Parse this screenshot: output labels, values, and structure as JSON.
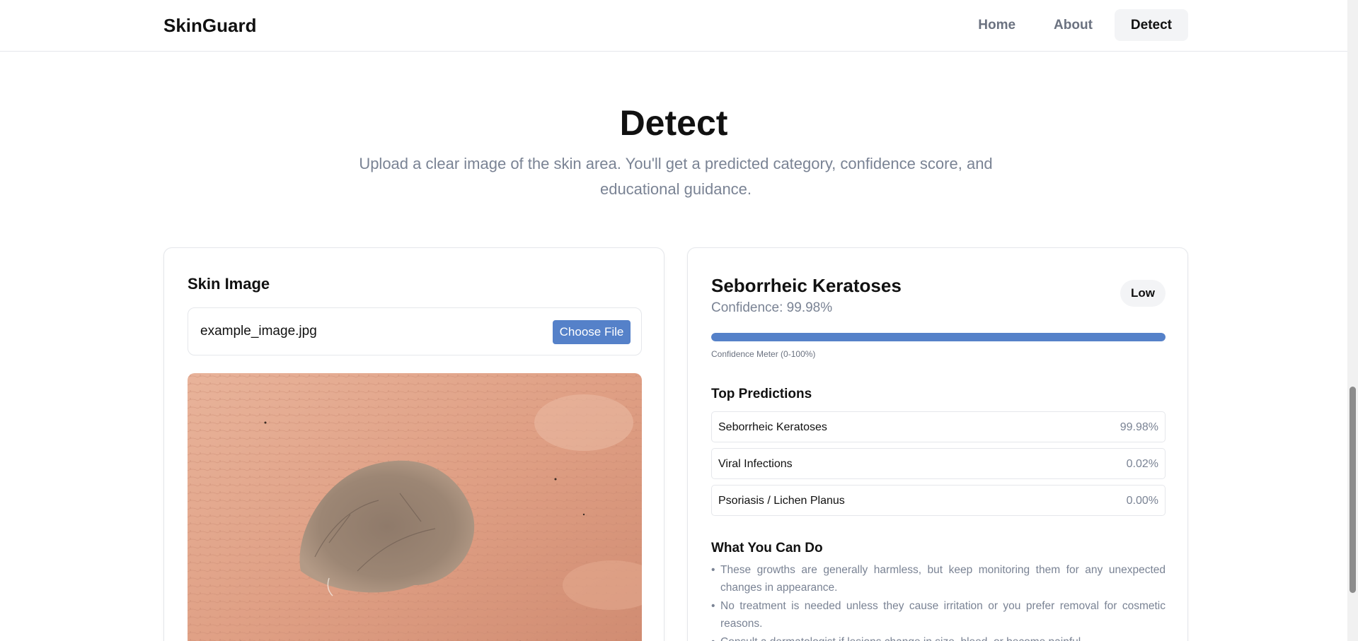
{
  "nav": {
    "brand": "SkinGuard",
    "links": [
      {
        "label": "Home"
      },
      {
        "label": "About"
      },
      {
        "label": "Detect"
      }
    ]
  },
  "hero": {
    "title": "Detect",
    "subtitle": "Upload a clear image of the skin area. You'll get a predicted category, confidence score, and educational guidance."
  },
  "upload": {
    "card_title": "Skin Image",
    "file_name": "example_image.jpg",
    "choose_button": "Choose File"
  },
  "result": {
    "prediction": "Seborrheic Keratoses",
    "confidence_text": "Confidence: 99.98%",
    "confidence_value": 99.98,
    "risk_badge": "Low",
    "meter_caption": "Confidence Meter (0-100%)",
    "top_title": "Top Predictions",
    "top_predictions": [
      {
        "name": "Seborrheic Keratoses",
        "value": "99.98%"
      },
      {
        "name": "Viral Infections",
        "value": "0.02%"
      },
      {
        "name": "Psoriasis / Lichen Planus",
        "value": "0.00%"
      }
    ],
    "advice_title": "What You Can Do",
    "advice": [
      "These growths are generally harmless, but keep monitoring them for any unexpected changes in appearance.",
      "No treatment is needed unless they cause irritation or you prefer removal for cosmetic reasons.",
      "Consult a dermatologist if lesions change in size, bleed, or become painful."
    ]
  },
  "colors": {
    "accent": "#5581c9",
    "muted_text": "#7a8394",
    "border": "#e5e7eb"
  }
}
